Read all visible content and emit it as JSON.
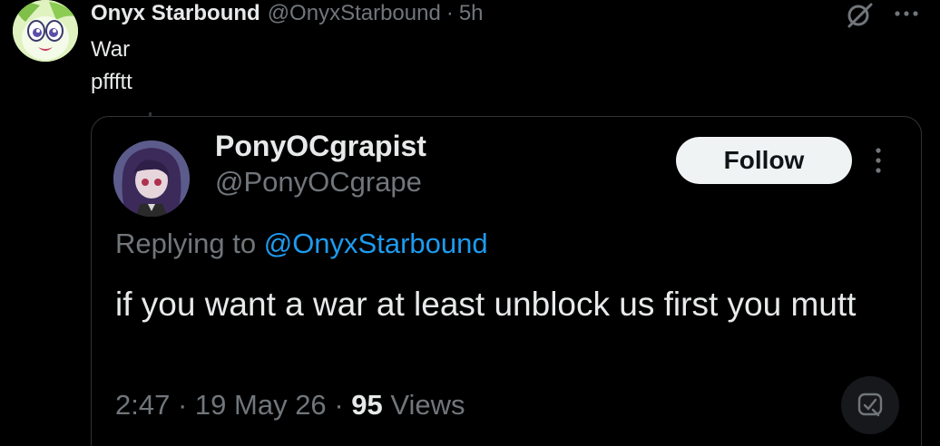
{
  "post": {
    "author_name": "Onyx Starbound",
    "author_handle": "@OnyxStarbound",
    "separator": "·",
    "time": "5h",
    "lines": [
      "War",
      "pffftt"
    ],
    "avatar_icon": "pony-avatar",
    "grok_icon": "grok-icon",
    "more_icon": "more-dots-icon"
  },
  "quote": {
    "author_name": "PonyOCgrapist",
    "author_handle": "@PonyOCgrape",
    "follow_label": "Follow",
    "replying_prefix": "Replying to",
    "replying_handle": "@OnyxStarbound",
    "text": "if you want a war at least unblock us first you mutt",
    "time": "2:47",
    "date": "19 May 26",
    "views_count": "95",
    "views_label": "Views",
    "separator": "·",
    "avatar_icon": "character-avatar",
    "more_icon": "vertical-dots-icon",
    "grok_bubble_icon": "grok-explain-icon"
  },
  "colors": {
    "background": "#000000",
    "text_primary": "#e7e9ea",
    "text_secondary": "#71767b",
    "link": "#1d9bf0",
    "border": "#2f3336",
    "follow_bg": "#eff3f4"
  }
}
